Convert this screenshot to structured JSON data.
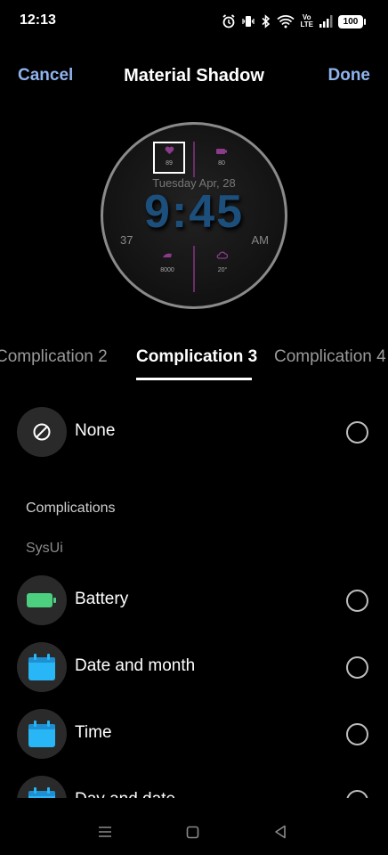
{
  "status": {
    "time": "12:13",
    "lte_label": "Vo\nLTE",
    "battery": "100"
  },
  "header": {
    "cancel": "Cancel",
    "title": "Material Shadow",
    "done": "Done"
  },
  "watch": {
    "comp_top_left_value": "89",
    "comp_top_right_value": "80",
    "date": "Tuesday Apr, 28",
    "time": "9:45",
    "left_value": "37",
    "ampm": "AM",
    "comp_bottom_left_value": "8000",
    "comp_bottom_right_value": "20°",
    "accent_color": "#6b2d6b",
    "time_color": "#1c4f7c"
  },
  "tabs": [
    {
      "label": "Complication 2"
    },
    {
      "label": "Complication 3"
    },
    {
      "label": "Complication 4"
    }
  ],
  "list": {
    "none_label": "None",
    "section_title": "Complications",
    "section_source": "SysUi",
    "items": [
      {
        "label": "Battery",
        "icon": "battery-icon",
        "color": "#4cd080"
      },
      {
        "label": "Date and month",
        "icon": "calendar-icon",
        "color": "#29b6f6"
      },
      {
        "label": "Time",
        "icon": "calendar-icon",
        "color": "#29b6f6"
      },
      {
        "label": "Day and date",
        "icon": "calendar-icon",
        "color": "#29b6f6"
      }
    ]
  },
  "colors": {
    "accent": "#8fb3ee",
    "background": "#000000"
  }
}
